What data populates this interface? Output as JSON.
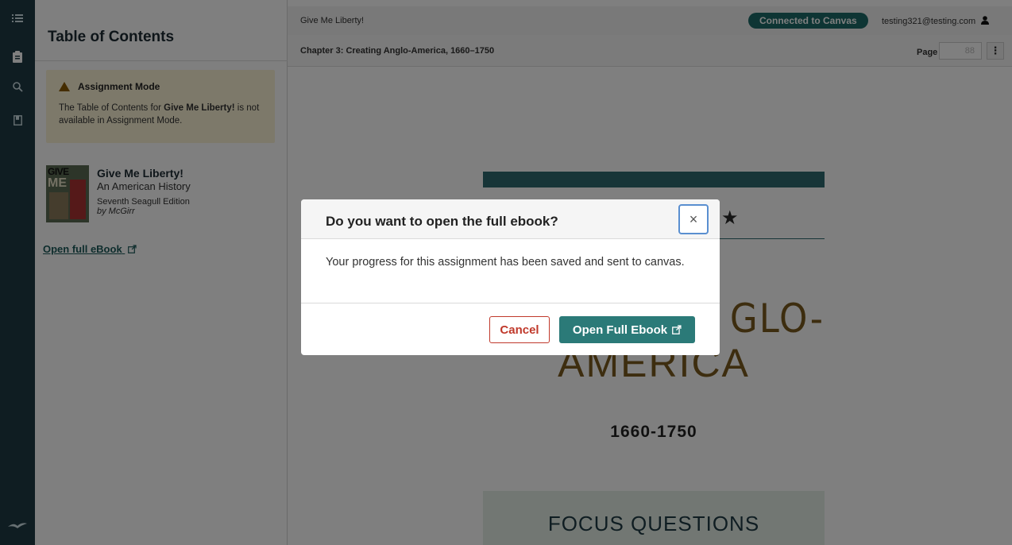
{
  "rail": {
    "icons": [
      "list-icon",
      "clipboard-icon",
      "search-icon",
      "bookmark-icon",
      "logo-bird-icon"
    ]
  },
  "toc": {
    "title": "Table of Contents",
    "notice": {
      "title": "Assignment Mode",
      "body_prefix": "The Table of Contents for ",
      "body_bold": "Give Me Liberty!",
      "body_suffix": " is not available in Assignment Mode."
    },
    "book": {
      "cover_text_1": "GIVE",
      "cover_text_2": "ME",
      "title": "Give Me Liberty!",
      "subtitle": "An American History",
      "edition": "Seventh Seagull Edition",
      "author": "by McGirr"
    },
    "open_link": "Open full eBook",
    "open_link_icon": "external-link-icon"
  },
  "header": {
    "title": "Give Me Liberty!",
    "status": "Connected to Canvas",
    "user": "testing321@testing.com",
    "user_icon": "user-icon"
  },
  "chapter": {
    "title": "Chapter 3: Creating Anglo-America, 1660–1750",
    "page_label": "Page",
    "page_value": "88",
    "menu_icon": "kebab-icon"
  },
  "ebook": {
    "star": "★",
    "title_line1": "GLO-",
    "title_line2": "AMERICA",
    "years": "1660-1750",
    "focus": "FOCUS QUESTIONS"
  },
  "modal": {
    "title": "Do you want to open the full ebook?",
    "close": "×",
    "body": "Your progress for this assignment has been saved and sent to canvas.",
    "cancel": "Cancel",
    "open": "Open Full Ebook",
    "open_icon": "external-link-icon"
  },
  "colors": {
    "rail": "#1f3a44",
    "accent": "#2b7a78",
    "danger": "#c0392b",
    "notice_bg": "#fbf3d4",
    "title_gold": "#7a5a1e"
  }
}
